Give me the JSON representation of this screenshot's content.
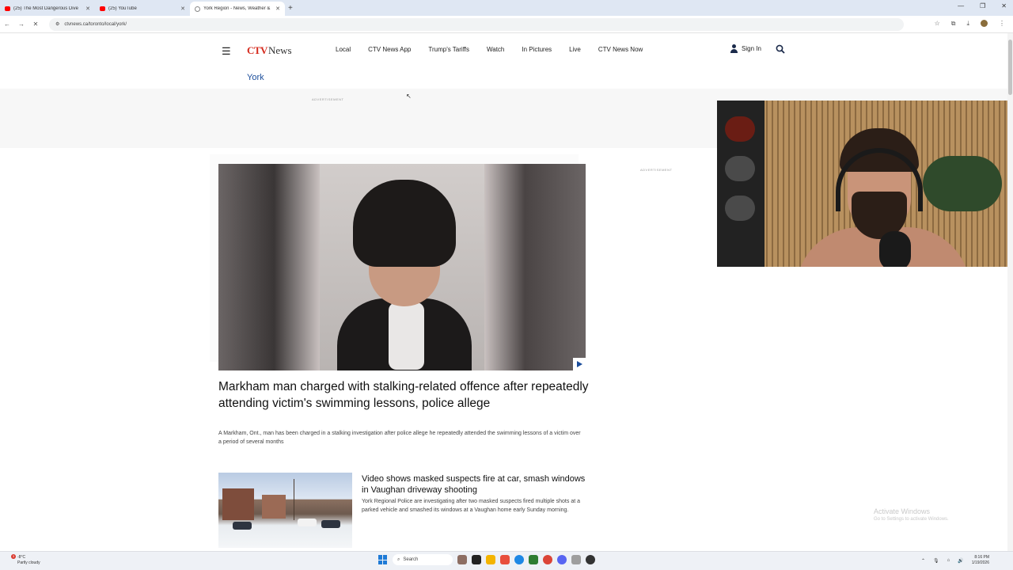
{
  "browser": {
    "tabs": [
      {
        "title": "(25) The Most Dangerous Dive",
        "active": false
      },
      {
        "title": "(25) YouTube",
        "active": false
      },
      {
        "title": "York Region - News, Weather &",
        "active": true
      }
    ],
    "url": "ctvnews.ca/toronto/local/york/"
  },
  "site": {
    "logo_ctv": "CTV",
    "logo_news": "News",
    "nav": [
      "Local",
      "CTV News App",
      "Trump's Tariffs",
      "Watch",
      "In Pictures",
      "Live",
      "CTV News Now"
    ],
    "sign_in": "Sign In",
    "section": "York",
    "ad_label": "ADVERTISEMENT",
    "brand_color": "#d52b1e",
    "link_color": "#1b4d9b"
  },
  "lead_story": {
    "headline": "Markham man charged with stalking-related offence after repeatedly attending victim's swimming lessons, police allege",
    "summary": "A Markham, Ont., man has been charged in a stalking investigation after police allege he repeatedly attended the swimming lessons of a victim over a period of several months"
  },
  "second_story": {
    "headline": "Video shows masked suspects fire at car, smash windows in Vaughan driveway shooting",
    "summary": "York Regional Police are investigating after two masked suspects fired multiple shots at a parked vehicle and smashed its windows at a Vaughan home early Sunday morning."
  },
  "watermark": {
    "title": "Activate Windows",
    "subtitle": "Go to Settings to activate Windows."
  },
  "taskbar": {
    "weather_temp": "-8°C",
    "weather_desc": "Partly cloudy",
    "notification_count": "3",
    "search_placeholder": "Search",
    "time": "8:16 PM",
    "date": "1/19/2026"
  }
}
